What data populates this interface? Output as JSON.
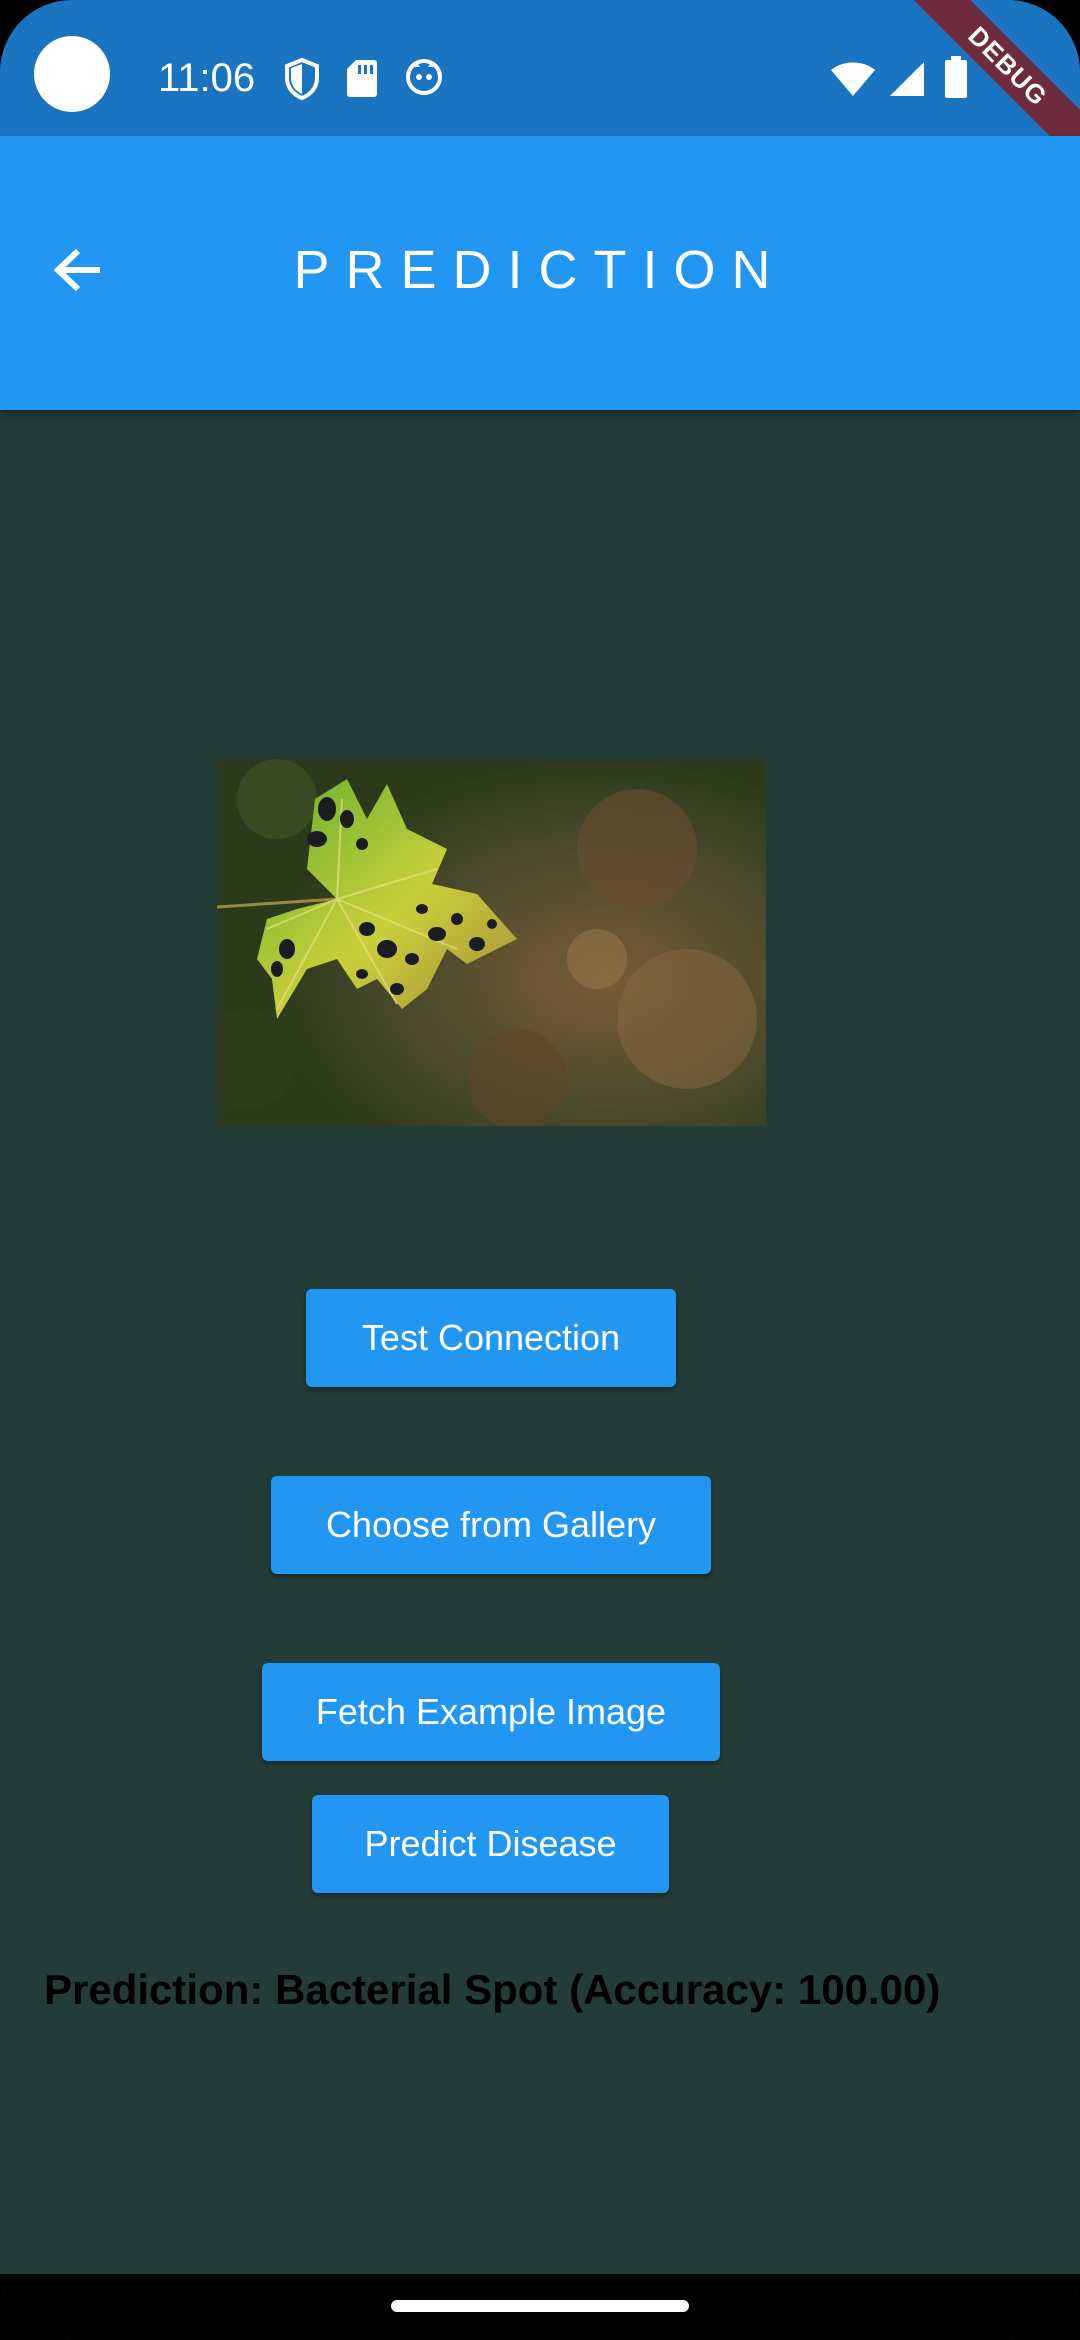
{
  "status_bar": {
    "time": "11:06",
    "left_icons": [
      "shield-icon",
      "sd-card-icon",
      "cat-face-icon"
    ],
    "right_icons": [
      "wifi-icon",
      "signal-icon",
      "battery-icon"
    ],
    "debug_label": "DEBUG"
  },
  "app_bar": {
    "title": "PREDICTION",
    "back_icon": "arrow-back-icon"
  },
  "image": {
    "description_icon": "leaf-photo"
  },
  "buttons": {
    "test_connection": "Test Connection",
    "choose_gallery": "Choose from Gallery",
    "fetch_example": "Fetch Example Image",
    "predict_disease": "Predict Disease"
  },
  "result": {
    "text": "Prediction: Bacterial Spot (Accuracy: 100.00)"
  },
  "colors": {
    "status_bar": "#1A74C0",
    "app_bar": "#2196F3",
    "background": "#233C37",
    "button": "#2196F3"
  }
}
